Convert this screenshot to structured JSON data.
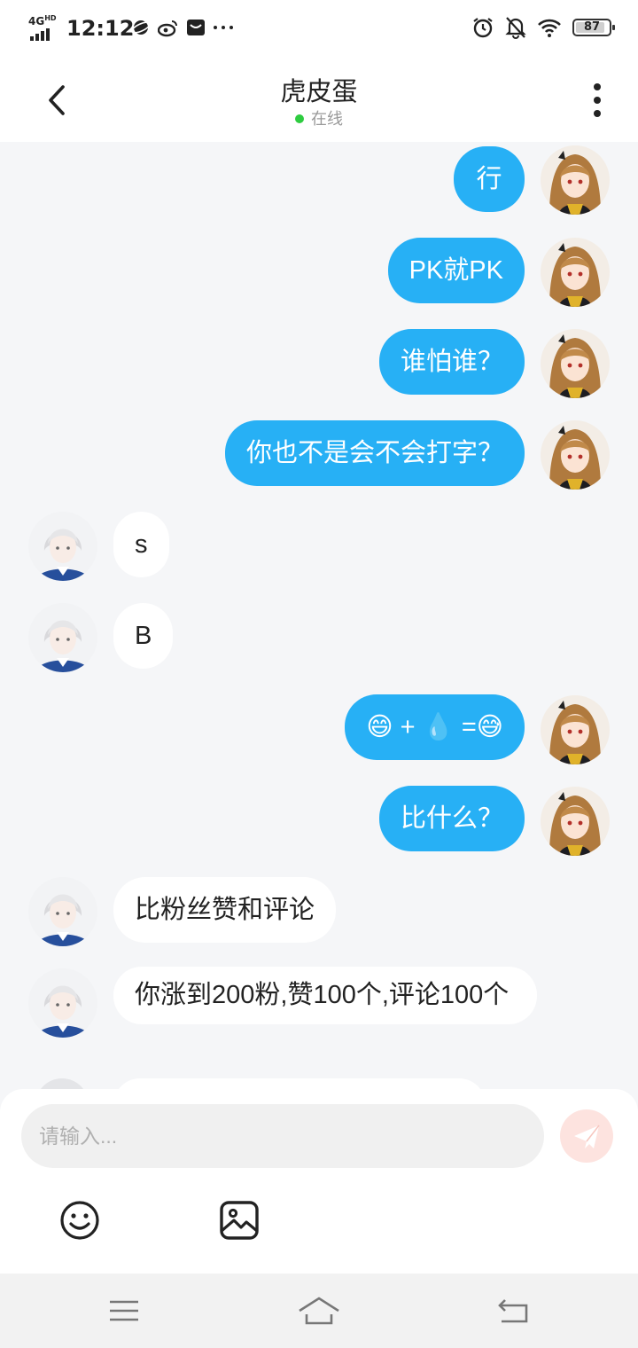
{
  "status_bar": {
    "network": "4G",
    "network_sup": "HD",
    "time": "12:12",
    "battery": "87",
    "left_icons": [
      "planet-icon",
      "weibo-icon",
      "mail-icon",
      "more-dots-icon"
    ],
    "right_icons": [
      "alarm-icon",
      "mute-bell-icon",
      "wifi-icon",
      "battery-icon"
    ]
  },
  "header": {
    "title": "虎皮蛋",
    "presence": "在线",
    "presence_color": "#2ecc40"
  },
  "colors": {
    "my_bubble": "#27b0f5",
    "their_bubble": "#ffffff",
    "background": "#f5f6f8"
  },
  "messages": [
    {
      "sender": "me",
      "text": "行"
    },
    {
      "sender": "me",
      "text": "PK就PK"
    },
    {
      "sender": "me",
      "text": "谁怕谁？"
    },
    {
      "sender": "me",
      "text": "你也不是会不会打字？"
    },
    {
      "sender": "other",
      "text": "s"
    },
    {
      "sender": "other",
      "text": "B"
    },
    {
      "sender": "me",
      "text": "😄 + 💧 =😅"
    },
    {
      "sender": "me",
      "text": "比什么？"
    },
    {
      "sender": "other",
      "text": "比粉丝赞和评论"
    },
    {
      "sender": "other",
      "text": "你涨到200粉,赞100个,评论100个"
    }
  ],
  "composer": {
    "placeholder": "请输入...",
    "icons": [
      "send-icon",
      "emoji-icon",
      "image-icon"
    ]
  },
  "nav": [
    "menu-icon",
    "home-icon",
    "back-icon"
  ]
}
